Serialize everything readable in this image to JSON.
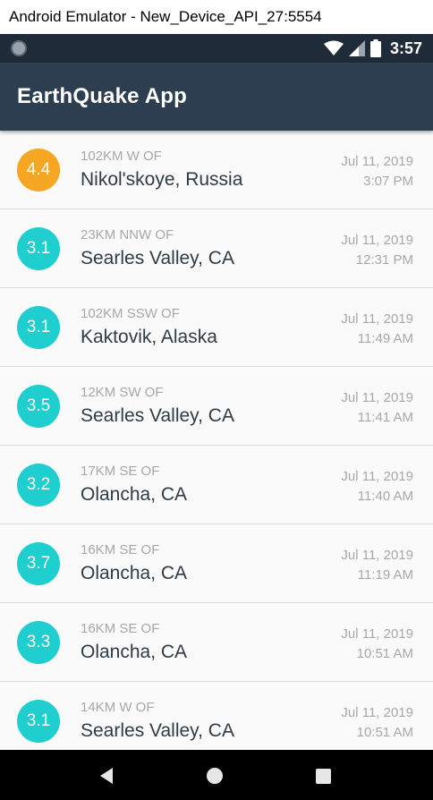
{
  "window": {
    "title": "Android Emulator - New_Device_API_27:5554"
  },
  "status_bar": {
    "time": "3:57",
    "icons": [
      "notification-dot-icon",
      "wifi-icon",
      "signal-icon",
      "battery-icon"
    ]
  },
  "app_bar": {
    "title": "EarthQuake App"
  },
  "colors": {
    "appbar": "#2c3e50",
    "status_bar": "#1f2b38",
    "mag_orange": "#f5a623",
    "mag_teal": "#1fcfcf"
  },
  "earthquakes": [
    {
      "magnitude": "4.4",
      "offset": "102KM W OF",
      "place": "Nikol'skoye, Russia",
      "date": "Jul 11, 2019",
      "time": "3:07 PM",
      "color": "#f5a623"
    },
    {
      "magnitude": "3.1",
      "offset": "23KM NNW OF",
      "place": "Searles Valley, CA",
      "date": "Jul 11, 2019",
      "time": "12:31 PM",
      "color": "#1fcfcf"
    },
    {
      "magnitude": "3.1",
      "offset": "102KM SSW OF",
      "place": "Kaktovik, Alaska",
      "date": "Jul 11, 2019",
      "time": "11:49 AM",
      "color": "#1fcfcf"
    },
    {
      "magnitude": "3.5",
      "offset": "12KM SW OF",
      "place": "Searles Valley, CA",
      "date": "Jul 11, 2019",
      "time": "11:41 AM",
      "color": "#1fcfcf"
    },
    {
      "magnitude": "3.2",
      "offset": "17KM SE OF",
      "place": "Olancha, CA",
      "date": "Jul 11, 2019",
      "time": "11:40 AM",
      "color": "#1fcfcf"
    },
    {
      "magnitude": "3.7",
      "offset": "16KM SE OF",
      "place": "Olancha, CA",
      "date": "Jul 11, 2019",
      "time": "11:19 AM",
      "color": "#1fcfcf"
    },
    {
      "magnitude": "3.3",
      "offset": "16KM SE OF",
      "place": "Olancha, CA",
      "date": "Jul 11, 2019",
      "time": "10:51 AM",
      "color": "#1fcfcf"
    },
    {
      "magnitude": "3.1",
      "offset": "14KM W OF",
      "place": "Searles Valley, CA",
      "date": "Jul 11, 2019",
      "time": "10:51 AM",
      "color": "#1fcfcf"
    }
  ],
  "nav_bar": {
    "icons": [
      "back-icon",
      "home-icon",
      "recents-icon"
    ]
  }
}
